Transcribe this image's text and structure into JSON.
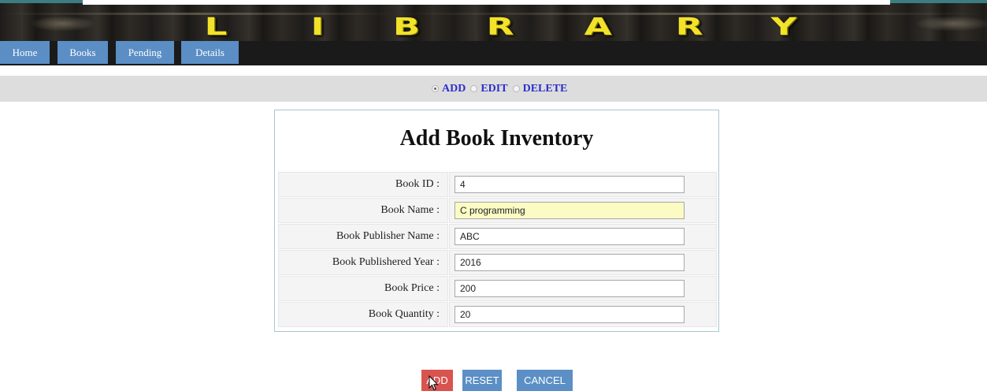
{
  "banner": {
    "letters": [
      "L",
      "I",
      "B",
      "R",
      "A",
      "R",
      "Y"
    ],
    "letter_color": "#f2e229"
  },
  "nav": {
    "items": [
      {
        "label": "Home"
      },
      {
        "label": "Books"
      },
      {
        "label": "Pending"
      },
      {
        "label": "Details"
      }
    ]
  },
  "mode_selector": {
    "options": [
      {
        "label": "ADD",
        "checked": true
      },
      {
        "label": "EDIT",
        "checked": false
      },
      {
        "label": "DELETE",
        "checked": false
      }
    ]
  },
  "form": {
    "title": "Add Book Inventory",
    "fields": [
      {
        "label": "Book ID :",
        "value": "4"
      },
      {
        "label": "Book Name :",
        "value": "C programming",
        "focused": true
      },
      {
        "label": "Book Publisher Name :",
        "value": "ABC"
      },
      {
        "label": "Book Publishered Year :",
        "value": "2016"
      },
      {
        "label": "Book Price :",
        "value": "200"
      },
      {
        "label": "Book Quantity :",
        "value": "20"
      }
    ]
  },
  "buttons": {
    "add": "ADD",
    "reset": "RESET",
    "cancel": "CANCEL"
  },
  "colors": {
    "nav_accent": "#5a8ec5",
    "add_button": "#d9534f",
    "secondary_button": "#5b8fc6",
    "radio_label": "#2a2fc9",
    "focused_input": "#fafcc4"
  },
  "cursor_icon": "mouse-pointer-icon"
}
